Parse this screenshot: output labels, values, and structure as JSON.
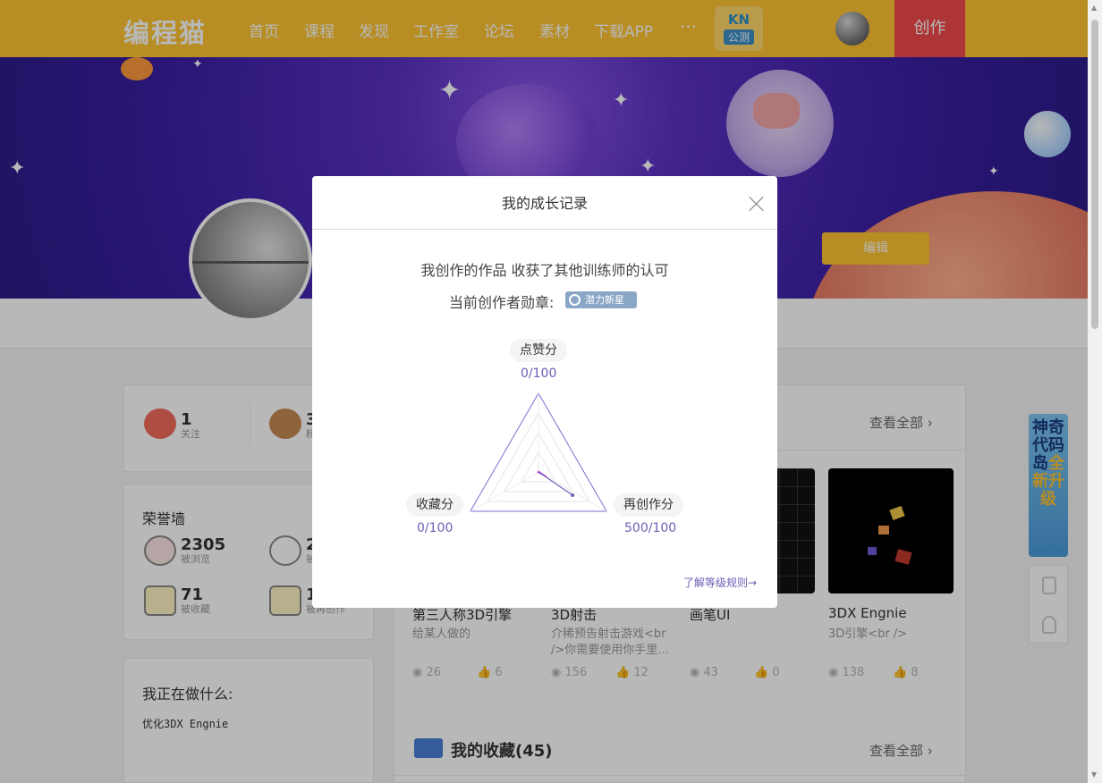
{
  "nav": {
    "logo": "编程猫",
    "items": [
      "首页",
      "课程",
      "发现",
      "工作室",
      "论坛",
      "素材",
      "下载APP"
    ],
    "more": "···",
    "kn_label": "KN",
    "kn_sub": "公测",
    "create_label": "创作"
  },
  "profile": {
    "edit_label": "编辑"
  },
  "follow": {
    "following_count": "1",
    "following_label": "关注",
    "fans_count": "3",
    "fans_label": "粉丝"
  },
  "honor": {
    "title": "荣誉墙",
    "views_count": "2305",
    "views_label": "被浏览",
    "likes_count": "2",
    "likes_label": "被点赞",
    "collects_count": "71",
    "collects_label": "被收藏",
    "recreate_count": "1",
    "recreate_label": "被再创作"
  },
  "doing": {
    "title": "我正在做什么:",
    "text": "优化3DX Engnie"
  },
  "works": {
    "see_all": "查看全部",
    "items": [
      {
        "title": "第三人称3D引擎",
        "desc": "给某人做的",
        "views": "26",
        "likes": "6"
      },
      {
        "title": "3D射击",
        "desc": "介稀预告射击游戏<br />你需要使用你手里…",
        "views": "156",
        "likes": "12"
      },
      {
        "title": "画笔UI",
        "desc": "",
        "views": "43",
        "likes": "0"
      },
      {
        "title": "3DX Engnie",
        "desc": "3D引擎<br />",
        "views": "138",
        "likes": "8"
      }
    ]
  },
  "favorites": {
    "title": "我的收藏(45)",
    "see_all": "查看全部"
  },
  "side": {
    "banner_top": "神奇代码岛",
    "banner_hl": "全新升级"
  },
  "modal": {
    "title": "我的成长记录",
    "message": "我创作的作品 收获了其他训练师的认可",
    "medal_label": "当前创作者勋章:",
    "medal_name": "潜力新星",
    "rules_link": "了解等级规则→",
    "radar": {
      "like": {
        "label": "点赞分",
        "score": "0/100",
        "value": 0,
        "max": 100
      },
      "collect": {
        "label": "收藏分",
        "score": "0/100",
        "value": 0,
        "max": 100
      },
      "recreate": {
        "label": "再创作分",
        "score": "500/100",
        "value": 500,
        "max": 100
      }
    }
  },
  "colors": {
    "nav_bg": "#fec433",
    "create_bg": "#f24a4a",
    "accent": "#6a5fb3",
    "radar_stroke": "#7b6fd0",
    "radar_inner": "#d04ad0"
  }
}
